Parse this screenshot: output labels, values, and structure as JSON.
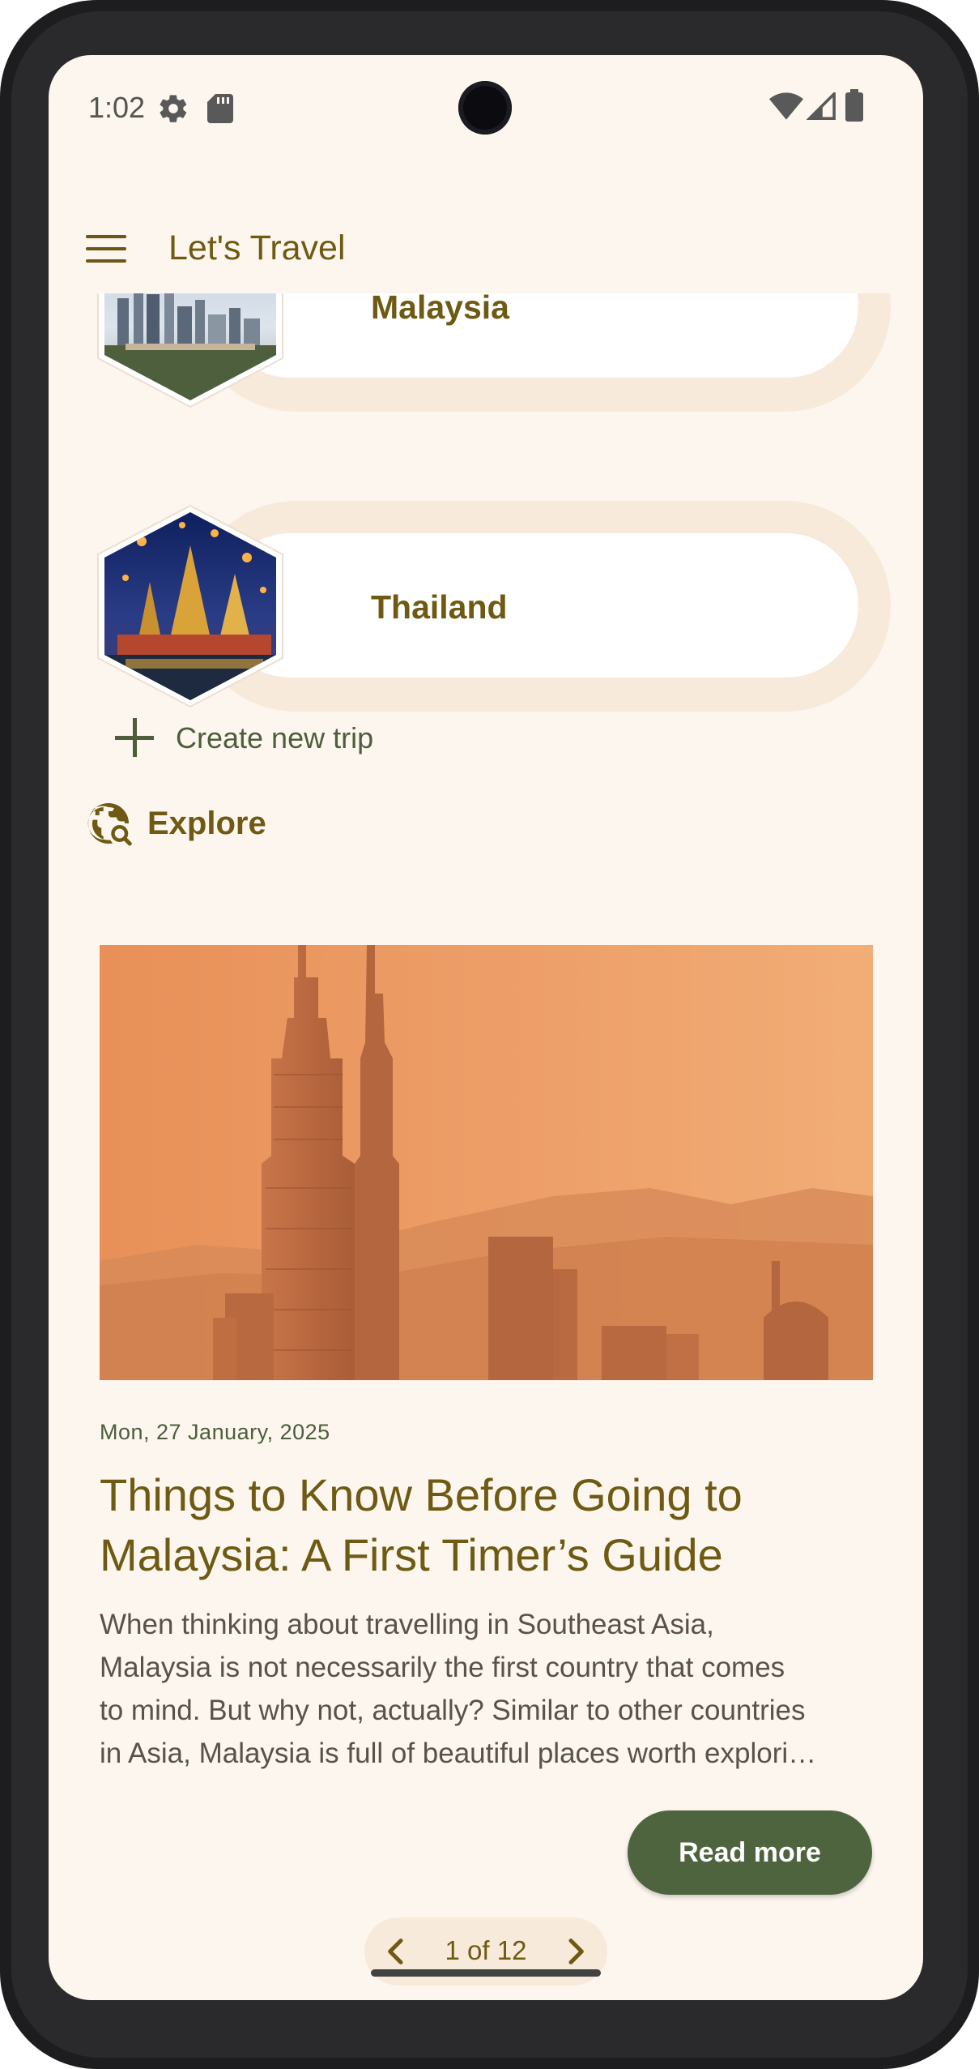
{
  "status_bar": {
    "time": "1:02",
    "left_icons": [
      "settings-icon",
      "sd-card-icon"
    ],
    "right_icons": [
      "wifi-icon",
      "signal-icon",
      "battery-icon"
    ]
  },
  "app_bar": {
    "title": "Let's Travel",
    "menu_icon": "hamburger-menu-icon"
  },
  "trips": [
    {
      "name": "Malaysia"
    },
    {
      "name": "Thailand"
    }
  ],
  "create_trip": {
    "label": "Create new trip",
    "icon": "plus-icon"
  },
  "explore": {
    "label": "Explore",
    "icon": "travel-explore-icon"
  },
  "article": {
    "date": "Mon, 27 January, 2025",
    "title": "Things to Know Before Going to Malaysia: A First Timer’s Guide",
    "excerpt_lines": [
      "When thinking about travelling in Southeast Asia,",
      "Malaysia is not necessarily the first country that comes",
      "to mind. But why not, actually? Similar to other countries",
      "in Asia, Malaysia is full of beautiful places worth explori…"
    ],
    "read_more_label": "Read more"
  },
  "pagination": {
    "label": "1 of 12",
    "current": 1,
    "total": 12,
    "prev_icon": "chevron-left-icon",
    "next_icon": "chevron-right-icon"
  },
  "colors": {
    "background": "#fdf6ef",
    "primary": "#6e5a12",
    "secondary": "#4c5e3b",
    "button": "#4e643f",
    "card_outer": "#f8eadb"
  }
}
